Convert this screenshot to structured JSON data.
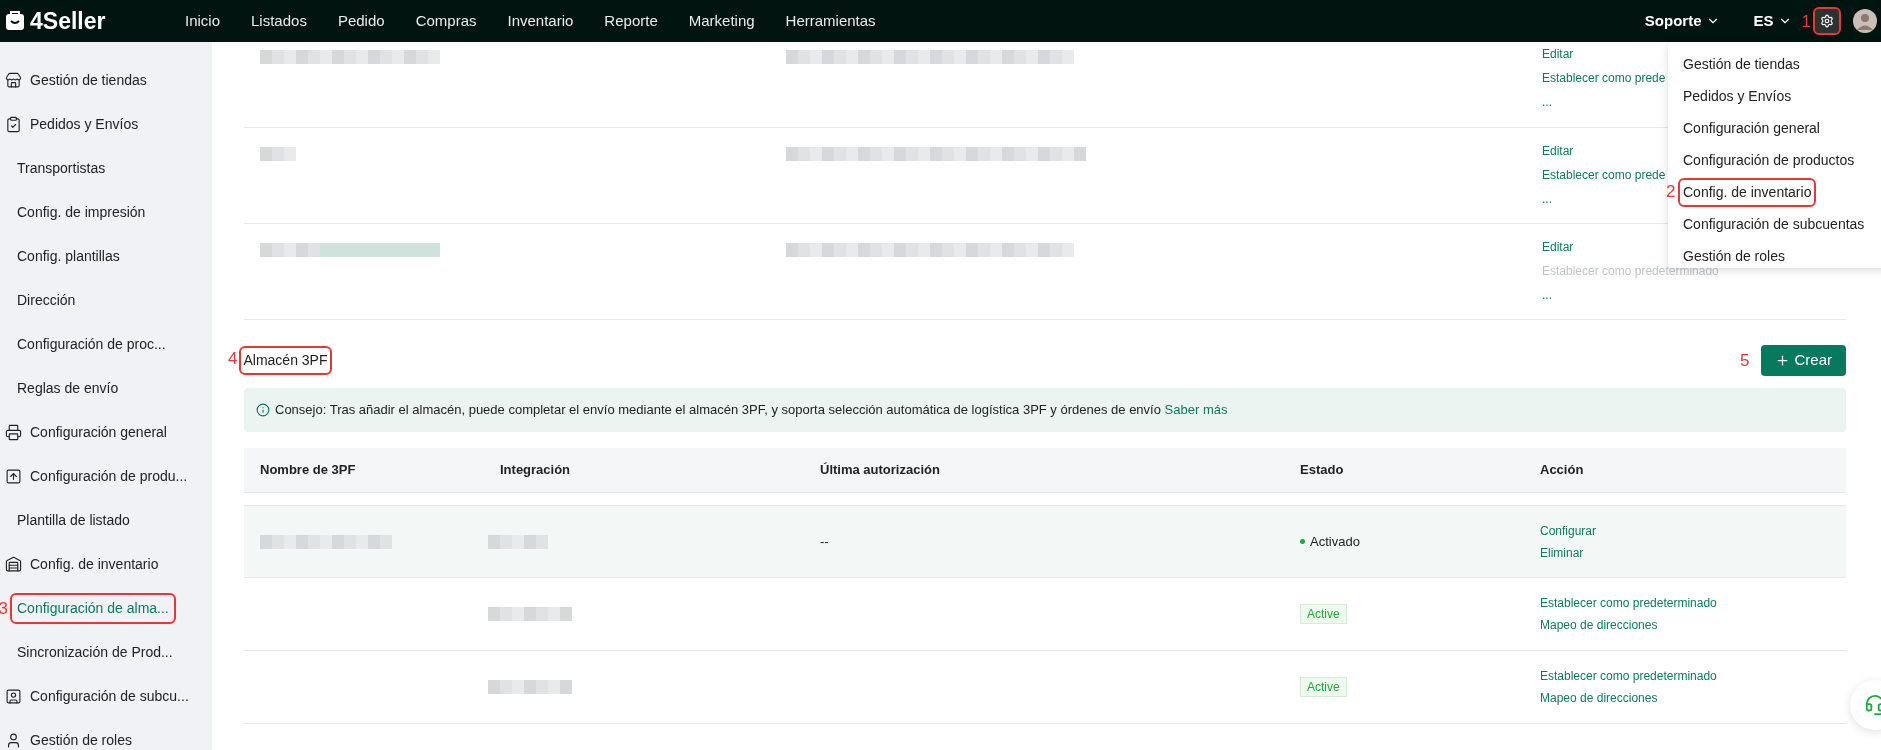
{
  "top_nav": {
    "logo": "4Seller",
    "items": [
      {
        "label": "Inicio"
      },
      {
        "label": "Listados"
      },
      {
        "label": "Pedido"
      },
      {
        "label": "Compras"
      },
      {
        "label": "Inventario"
      },
      {
        "label": "Reporte"
      },
      {
        "label": "Marketing"
      },
      {
        "label": "Herramientas"
      }
    ],
    "support": "Soporte",
    "language": "ES",
    "settings_callout": "1"
  },
  "settings_menu": {
    "items": [
      {
        "label": "Gestión de tiendas"
      },
      {
        "label": "Pedidos y Envíos"
      },
      {
        "label": "Configuración general"
      },
      {
        "label": "Configuración de productos"
      },
      {
        "label": "Config. de inventario",
        "callout": "2"
      },
      {
        "label": "Configuración de subcuentas"
      },
      {
        "label": "Gestión de roles"
      }
    ]
  },
  "sidebar": {
    "items": [
      {
        "label": "Gestión de tiendas",
        "kind": "store"
      },
      {
        "label": "Pedidos y Envíos",
        "kind": "clipboard",
        "children": [
          {
            "label": "Transportistas",
            "selected": false
          },
          {
            "label": "Config. de impresión",
            "selected": false
          },
          {
            "label": "Config. plantillas",
            "selected": false
          },
          {
            "label": "Dirección",
            "selected": false
          },
          {
            "label": "Configuración de proc...",
            "selected": false
          },
          {
            "label": "Reglas de envío",
            "selected": false
          }
        ]
      },
      {
        "label": "Configuración general",
        "kind": "printer"
      },
      {
        "label": "Configuración de produ...",
        "kind": "upload",
        "children": [
          {
            "label": "Plantilla de listado",
            "selected": false
          }
        ]
      },
      {
        "label": "Config. de inventario",
        "kind": "warehouse",
        "children": [
          {
            "label": "Configuración de alma...",
            "selected": true,
            "callout": "3"
          },
          {
            "label": "Sincronización de Prod...",
            "selected": false
          }
        ]
      },
      {
        "label": "Configuración de subcu...",
        "kind": "contact"
      },
      {
        "label": "Gestión de roles",
        "kind": "user"
      }
    ]
  },
  "warehouse_rows": [
    {
      "actions": [
        {
          "label": "Editar",
          "disabled": false
        },
        {
          "label": "Establecer como prede",
          "disabled": false
        },
        {
          "label": "...",
          "disabled": false
        }
      ]
    },
    {
      "actions": [
        {
          "label": "Editar",
          "disabled": false
        },
        {
          "label": "Establecer como prede",
          "disabled": false
        },
        {
          "label": "...",
          "disabled": false
        }
      ]
    },
    {
      "actions": [
        {
          "label": "Editar",
          "disabled": false
        },
        {
          "label": "Establecer como predeterminado",
          "disabled": true
        },
        {
          "label": "...",
          "disabled": false
        }
      ]
    }
  ],
  "section": {
    "title": "Almacén 3PF",
    "callout": "4",
    "create_button": {
      "label": "Crear",
      "callout": "5"
    }
  },
  "tip": {
    "text": "Consejo: Tras añadir el almacén, puede completar el envío mediante el almacén 3PF, y soporta selección automática de logística 3PF y órdenes de envío",
    "link": "Saber más"
  },
  "table": {
    "columns": [
      "Nombre de 3PF",
      "Integración",
      "Última autorización",
      "Estado",
      "Acción"
    ],
    "rows": [
      {
        "hovered": true,
        "last_authorization": "--",
        "status": {
          "kind": "dot",
          "label": "Activado"
        },
        "actions": [
          "Configurar",
          "Eliminar"
        ]
      },
      {
        "hovered": false,
        "status": {
          "kind": "tag",
          "label": "Active"
        },
        "actions": [
          "Establecer como predeterminado",
          "Mapeo de direcciones"
        ]
      },
      {
        "hovered": false,
        "status": {
          "kind": "tag",
          "label": "Active"
        },
        "actions": [
          "Establecer como predeterminado",
          "Mapeo de direcciones"
        ]
      }
    ]
  }
}
